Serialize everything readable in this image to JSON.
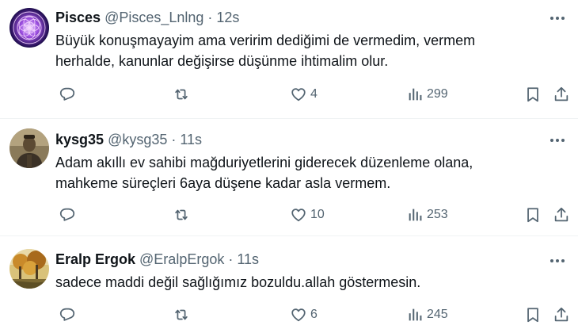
{
  "tweets": [
    {
      "name": "Pisces",
      "handle": "@Pisces_Lnlng",
      "dot": "·",
      "time": "12s",
      "text": "Büyük konuşmayayim ama veririm dediğimi de vermedim, vermem\nherhalde, kanunlar değişirse düşünme ihtimalim olur.",
      "likes": "4",
      "views": "299",
      "avatar": "pisces-mandala-avatar"
    },
    {
      "name": "kysg35",
      "handle": "@kysg35",
      "dot": "·",
      "time": "11s",
      "text": "Adam akıllı ev sahibi mağduriyetlerini giderecek düzenleme olana,\nmahkeme süreçleri 6aya düşene  kadar asla vermem.",
      "likes": "10",
      "views": "253",
      "avatar": "portrait-photo-avatar"
    },
    {
      "name": "Eralp Ergok",
      "handle": "@EralpErgok",
      "dot": "·",
      "time": "11s",
      "text": "sadece maddi değil sağlığımız bozuldu.allah göstermesin.",
      "likes": "6",
      "views": "245",
      "avatar": "autumn-landscape-avatar"
    }
  ],
  "icons": {
    "more": "more-horizontal-icon",
    "reply": "reply-icon",
    "retweet": "retweet-icon",
    "like": "heart-icon",
    "views": "views-bar-chart-icon",
    "bookmark": "bookmark-icon",
    "share": "share-icon"
  },
  "colors": {
    "text": "#0f1419",
    "secondary": "#536471",
    "divider": "#eff3f4"
  }
}
